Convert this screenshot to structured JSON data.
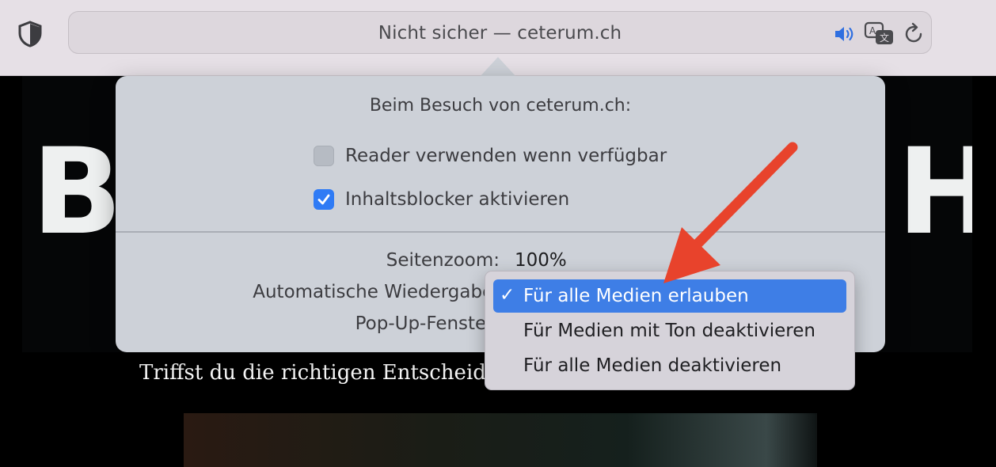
{
  "toolbar": {
    "address_text": "Nicht sicher — ceterum.ch",
    "icons": [
      "shield-icon",
      "speaker-icon",
      "translate-icon",
      "reload-icon"
    ]
  },
  "page": {
    "hero_letter_left": "B",
    "hero_letter_right": "H",
    "text_line": "Triffst du die richtigen Entscheidu"
  },
  "popover": {
    "title": "Beim Besuch von ceterum.ch:",
    "reader_label": "Reader verwenden wenn verfügbar",
    "reader_checked": false,
    "blocker_label": "Inhaltsblocker aktivieren",
    "blocker_checked": true,
    "zoom_label": "Seitenzoom:",
    "zoom_value": "100%",
    "autoplay_label": "Automatische Wiedergabe:",
    "popup_label": "Pop-Up-Fenster:"
  },
  "menu": {
    "items": [
      {
        "label": "Für alle Medien erlauben",
        "selected": true
      },
      {
        "label": "Für Medien mit Ton deaktivieren",
        "selected": false
      },
      {
        "label": "Für alle Medien deaktivieren",
        "selected": false
      }
    ],
    "checkmark": "✓"
  },
  "colors": {
    "accent": "#3e7ee6",
    "checkbox_on": "#2f7bf5",
    "arrow": "#e8432c"
  }
}
